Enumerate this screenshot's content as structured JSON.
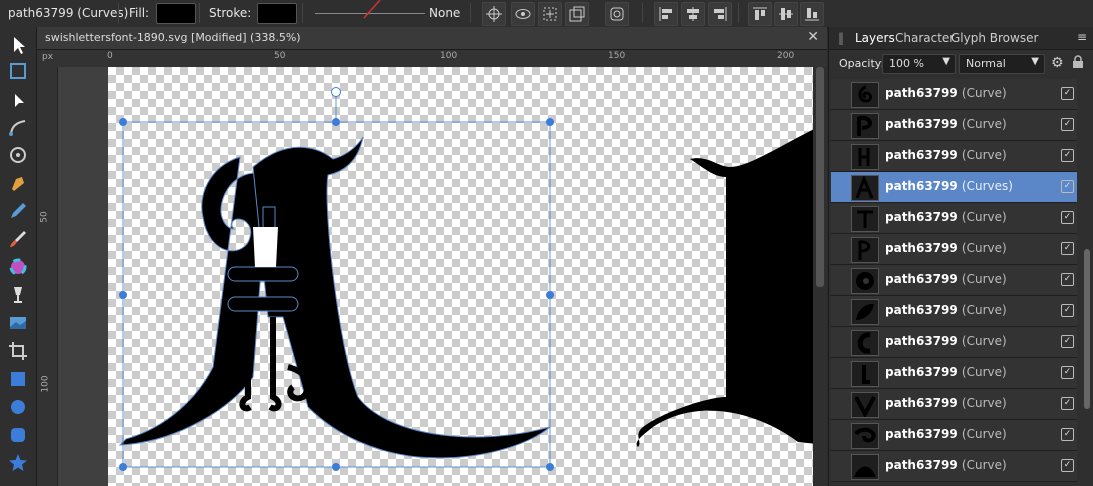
{
  "context_bar": {
    "selection_label": "path63799 (Curves)",
    "fill_label": "Fill:",
    "stroke_label": "Stroke:",
    "stroke_width_value": "None",
    "fill_color": "#000000",
    "stroke_color": "#000000"
  },
  "document": {
    "tab_title": "swishlettersfont-1890.svg [Modified] (338.5%)",
    "close_glyph": "✕"
  },
  "rulers": {
    "unit": "px",
    "top_labels": [
      "0",
      "50",
      "100",
      "150",
      "200"
    ],
    "left_labels": [
      "50",
      "100"
    ]
  },
  "panel": {
    "tabs": [
      "Layers",
      "Character",
      "Glyph Browser"
    ],
    "active_tab": "Layers",
    "opacity_label": "Opacity:",
    "opacity_value": "100 %",
    "blend_mode": "Normal",
    "layers": [
      {
        "name": "path63799",
        "type": "(Curve)",
        "icon": "swirl-glyph-icon",
        "selected": false
      },
      {
        "name": "path63799",
        "type": "(Curve)",
        "icon": "p-glyph-icon",
        "selected": false
      },
      {
        "name": "path63799",
        "type": "(Curve)",
        "icon": "h-glyph-icon",
        "selected": false
      },
      {
        "name": "path63799",
        "type": "(Curves)",
        "icon": "a-glyph-icon",
        "selected": true
      },
      {
        "name": "path63799",
        "type": "(Curve)",
        "icon": "t-glyph-icon",
        "selected": false
      },
      {
        "name": "path63799",
        "type": "(Curve)",
        "icon": "p-glyph-icon",
        "selected": false
      },
      {
        "name": "path63799",
        "type": "(Curve)",
        "icon": "spiral-glyph-icon",
        "selected": false
      },
      {
        "name": "path63799",
        "type": "(Curve)",
        "icon": "leaf-glyph-icon",
        "selected": false
      },
      {
        "name": "path63799",
        "type": "(Curve)",
        "icon": "c-glyph-icon",
        "selected": false
      },
      {
        "name": "path63799",
        "type": "(Curve)",
        "icon": "l-glyph-icon",
        "selected": false
      },
      {
        "name": "path63799",
        "type": "(Curve)",
        "icon": "v-glyph-icon",
        "selected": false
      },
      {
        "name": "path63799",
        "type": "(Curve)",
        "icon": "spiral-glyph-icon",
        "selected": false
      },
      {
        "name": "path63799",
        "type": "(Curve)",
        "icon": "mound-glyph-icon",
        "selected": false
      }
    ]
  },
  "accent_color": "#5b87c9"
}
